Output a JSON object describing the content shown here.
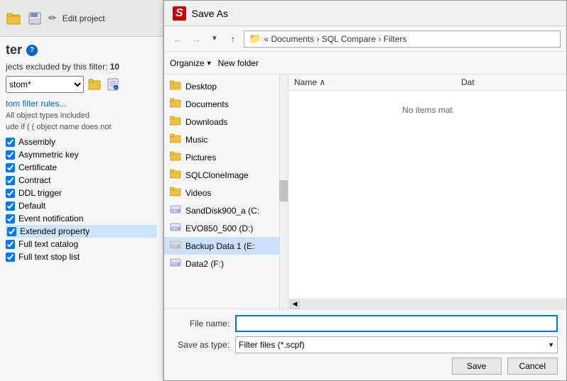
{
  "toolbar": {
    "open_icon": "📂",
    "save_icon": "💾",
    "edit_label": "Edit project"
  },
  "filter_panel": {
    "title": "ter",
    "help_icon": "?",
    "info_label": "jects excluded by this filter:",
    "excluded_count": "10",
    "dropdown_value": "stom*",
    "link_label": "tom filter rules...",
    "all_types_label": "All object types included",
    "condition_label": "ude if  (  ( object name does not",
    "objects": [
      {
        "label": "Assembly",
        "checked": true,
        "selected": false
      },
      {
        "label": "Asymmetric key",
        "checked": true,
        "selected": false
      },
      {
        "label": "Certificate",
        "checked": true,
        "selected": false
      },
      {
        "label": "Contract",
        "checked": true,
        "selected": false
      },
      {
        "label": "DDL trigger",
        "checked": true,
        "selected": false
      },
      {
        "label": "Default",
        "checked": true,
        "selected": false
      },
      {
        "label": "Event notification",
        "checked": true,
        "selected": false
      },
      {
        "label": "Extended property",
        "checked": true,
        "selected": true
      },
      {
        "label": "Full text catalog",
        "checked": true,
        "selected": false
      },
      {
        "label": "Full text stop list",
        "checked": true,
        "selected": false
      }
    ]
  },
  "dialog": {
    "title": "Save As",
    "title_icon": "S",
    "nav": {
      "back_disabled": true,
      "forward_disabled": true,
      "up_label": "↑",
      "breadcrumb": "« Documents › SQL Compare › Filters"
    },
    "toolbar": {
      "organize_label": "Organize",
      "new_folder_label": "New folder"
    },
    "sidebar_items": [
      {
        "label": "Desktop",
        "icon": "folder"
      },
      {
        "label": "Documents",
        "icon": "folder"
      },
      {
        "label": "Downloads",
        "icon": "folder"
      },
      {
        "label": "Music",
        "icon": "folder"
      },
      {
        "label": "Pictures",
        "icon": "folder"
      },
      {
        "label": "SQLCloneImage",
        "icon": "folder"
      },
      {
        "label": "Videos",
        "icon": "folder"
      },
      {
        "label": "SandDisk900_a (C:",
        "icon": "drive"
      },
      {
        "label": "EVO850_500 (D:)",
        "icon": "drive"
      },
      {
        "label": "Backup Data 1 (E:",
        "icon": "drive-gray",
        "selected": true
      },
      {
        "label": "Data2 (F:)",
        "icon": "drive"
      }
    ],
    "file_list": {
      "col_name": "Name",
      "col_date": "Dat",
      "sort_arrow": "∧",
      "empty_message": "No items mat"
    },
    "bottom": {
      "file_name_label": "File name:",
      "file_name_value": "",
      "save_type_label": "Save as type:",
      "save_type_value": "Filter files (*.scpf)",
      "save_btn": "Save",
      "cancel_btn": "Cancel"
    }
  }
}
